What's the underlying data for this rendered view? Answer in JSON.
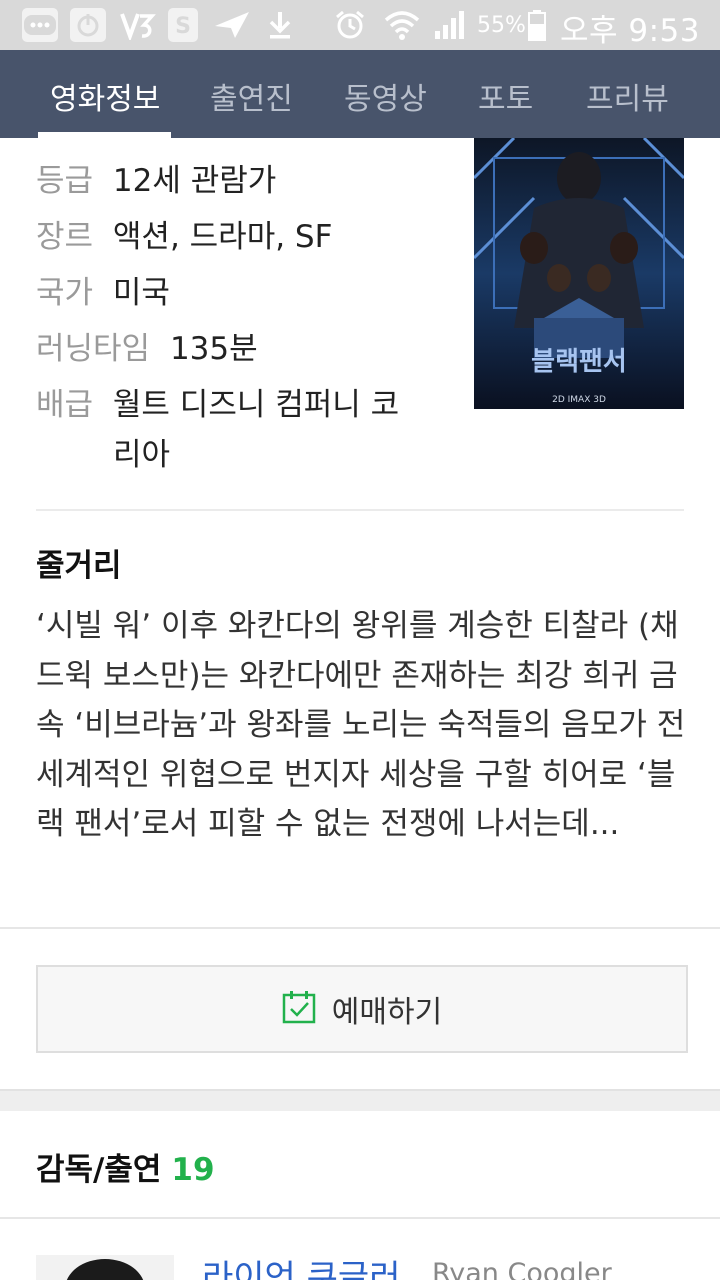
{
  "status_bar": {
    "battery_percent": "55%",
    "time": "오후 9:53",
    "icons": [
      "chat-icon",
      "power-icon",
      "v3-icon",
      "s-pay-icon",
      "send-icon",
      "download-icon",
      "alarm-icon",
      "wifi-icon",
      "signal-icon",
      "battery-icon"
    ]
  },
  "tabs": [
    {
      "label": "영화정보",
      "active": true
    },
    {
      "label": "출연진",
      "active": false
    },
    {
      "label": "동영상",
      "active": false
    },
    {
      "label": "포토",
      "active": false
    },
    {
      "label": "프리뷰",
      "active": false
    }
  ],
  "info": {
    "rating_label": "등급",
    "rating_value": "12세 관람가",
    "genre_label": "장르",
    "genre_value": "액션, 드라마, SF",
    "country_label": "국가",
    "country_value": "미국",
    "runtime_label": "러닝타임",
    "runtime_value": "135분",
    "distributor_label": "배급",
    "distributor_value_line1": "월트 디즈니 컴퍼니 코",
    "distributor_value_line2": "리아"
  },
  "poster": {
    "title_text": "블랙팬서",
    "tagline": "2D IMAX 3D"
  },
  "synopsis": {
    "title": "줄거리",
    "text": "‘시빌 워’ 이후 와칸다의 왕위를 계승한 티찰라 (채드윅 보스만)는 와칸다에만 존재하는 최강 희귀 금속 ‘비브라늄’과 왕좌를 노리는 숙적들의 음모가 전세계적인 위협으로 번지자 세상을 구할 히어로 ‘블랙 팬서’로서 피할 수 없는 전쟁에 나서는데..."
  },
  "booking": {
    "label": "예매하기",
    "accent": "#22b14c"
  },
  "cast": {
    "title": "감독/출연",
    "count": "19",
    "director_name_ko": "라이언 쿠글러",
    "director_name_en": "Ryan Coogler"
  }
}
